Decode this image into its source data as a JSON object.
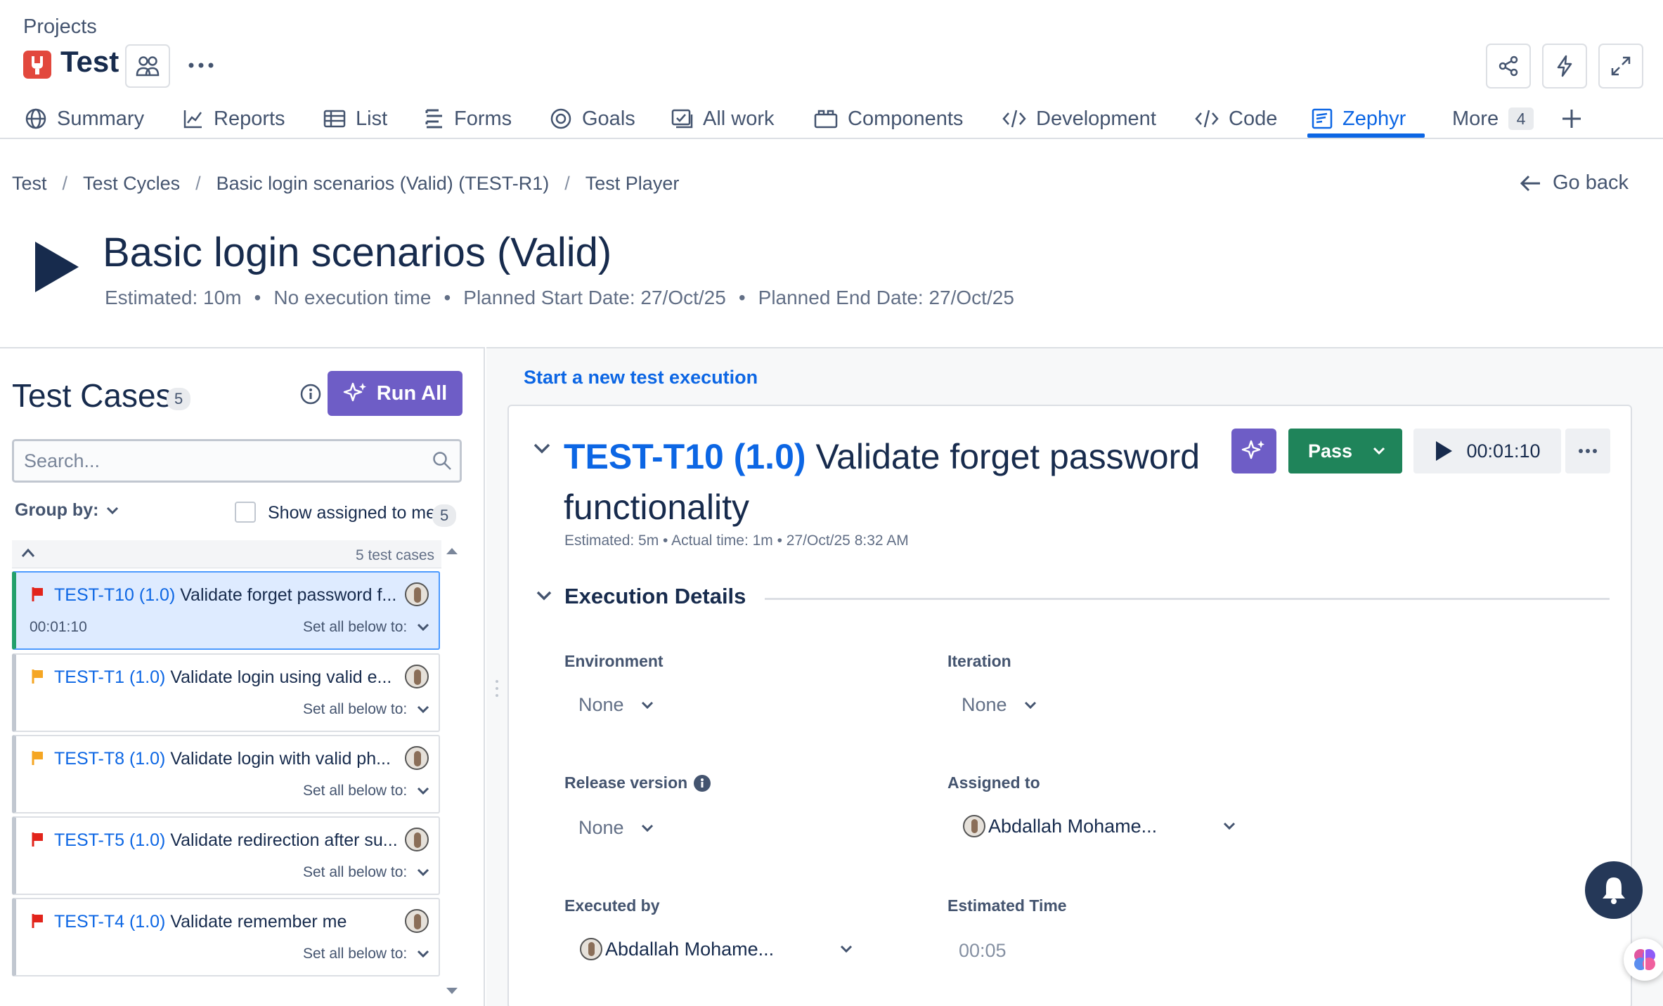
{
  "header": {
    "projects_label": "Projects",
    "project_name": "Test"
  },
  "tabs": [
    {
      "label": "Summary",
      "icon": "globe-icon"
    },
    {
      "label": "Reports",
      "icon": "chart-icon"
    },
    {
      "label": "List",
      "icon": "list-icon"
    },
    {
      "label": "Forms",
      "icon": "forms-icon"
    },
    {
      "label": "Goals",
      "icon": "target-icon"
    },
    {
      "label": "All work",
      "icon": "all-work-icon"
    },
    {
      "label": "Components",
      "icon": "components-icon"
    },
    {
      "label": "Development",
      "icon": "code-brackets-icon"
    },
    {
      "label": "Code",
      "icon": "code-icon"
    },
    {
      "label": "Zephyr",
      "icon": "zephyr-icon",
      "active": true
    },
    {
      "label": "More",
      "icon": "",
      "badge": "4"
    }
  ],
  "breadcrumbs": [
    "Test",
    "Test Cycles",
    "Basic login scenarios (Valid) (TEST-R1)",
    "Test Player"
  ],
  "go_back_label": "Go back",
  "cycle": {
    "title": "Basic login scenarios (Valid)",
    "meta": [
      "Estimated: 10m",
      "No execution time",
      "Planned Start Date: 27/Oct/25",
      "Planned End Date: 27/Oct/25"
    ]
  },
  "test_cases_panel": {
    "title": "Test Cases",
    "count": "5",
    "run_all_label": "Run All",
    "search_placeholder": "Search...",
    "group_by_label": "Group by:",
    "show_assigned_label": "Show assigned to me",
    "show_assigned_count": "5",
    "list_total": "5 test cases",
    "items": [
      {
        "key": "TEST-T10",
        "version": "(1.0)",
        "name": "Validate forget password f...",
        "flag_color": "#e2241b",
        "time": "00:01:10",
        "set_all": "Set all below to:"
      },
      {
        "key": "TEST-T1",
        "version": "(1.0)",
        "name": "Validate login using valid e...",
        "flag_color": "#f5a623",
        "time": "",
        "set_all": "Set all below to:"
      },
      {
        "key": "TEST-T8",
        "version": "(1.0)",
        "name": "Validate login with valid ph...",
        "flag_color": "#f5a623",
        "time": "",
        "set_all": "Set all below to:"
      },
      {
        "key": "TEST-T5",
        "version": "(1.0)",
        "name": "Validate redirection after su...",
        "flag_color": "#e2241b",
        "time": "",
        "set_all": "Set all below to:"
      },
      {
        "key": "TEST-T4",
        "version": "(1.0)",
        "name": "Validate remember me",
        "flag_color": "#e2241b",
        "time": "",
        "set_all": "Set all below to:"
      }
    ]
  },
  "execution": {
    "new_execution_link": "Start a new test execution",
    "key": "TEST-T10 (1.0)",
    "title": "Validate forget password functionality",
    "meta": "Estimated: 5m • Actual time: 1m • 27/Oct/25 8:32 AM",
    "status": "Pass",
    "status_color": "#1f845a",
    "timer": "00:01:10",
    "section_title": "Execution Details",
    "fields": {
      "environment_label": "Environment",
      "environment_value": "None",
      "iteration_label": "Iteration",
      "iteration_value": "None",
      "release_label": "Release version",
      "release_value": "None",
      "assigned_label": "Assigned to",
      "assigned_value": "Abdallah Mohame...",
      "executed_label": "Executed by",
      "executed_value": "Abdallah Mohame...",
      "estimated_label": "Estimated Time",
      "estimated_value": "00:05"
    }
  }
}
